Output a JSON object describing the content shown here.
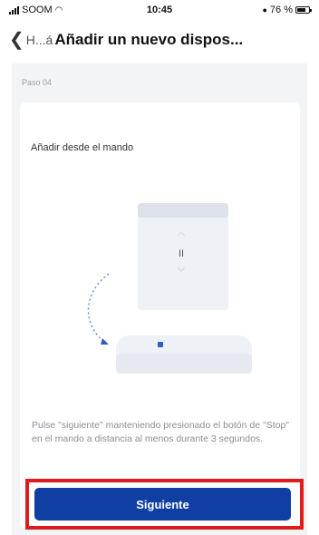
{
  "status_bar": {
    "carrier": "SOOM",
    "time": "10:45",
    "battery": "76 %",
    "battery_level": 0.76
  },
  "nav": {
    "back_label": "H...á",
    "title": "Añadir un nuevo dispos..."
  },
  "step": {
    "label": "Paso 04"
  },
  "card": {
    "title": "Añadir desde el mando",
    "instructions": "Pulse \"siguiente\" manteniendo presionado el botón de \"Stop\" en el mando a distancia al menos durante 3 segundos."
  },
  "illustration": {
    "remote_icon": "remote-control-icon",
    "hub_icon": "hub-device-icon",
    "arrow_icon": "curved-arrow-icon",
    "stop_symbol": "II"
  },
  "actions": {
    "next_label": "Siguiente"
  },
  "colors": {
    "primary": "#0f3fa3",
    "highlight": "#e01b1b",
    "background": "#f3f4f6"
  }
}
